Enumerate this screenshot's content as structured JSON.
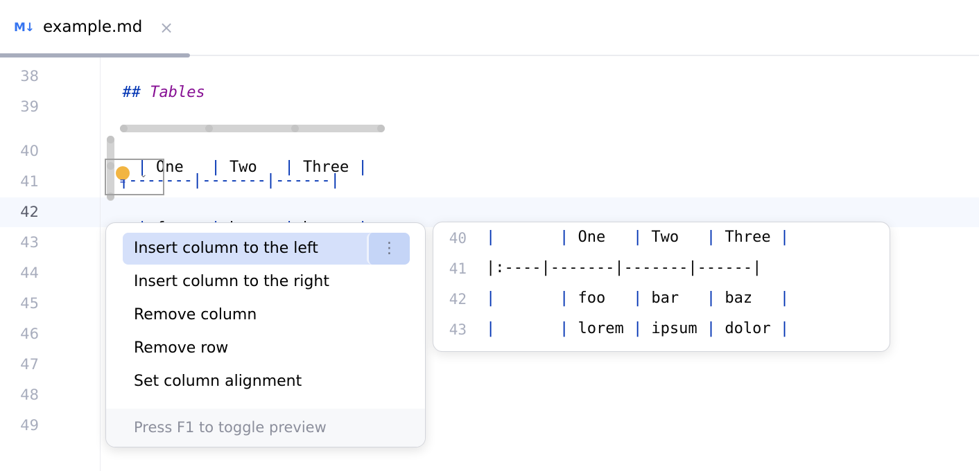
{
  "tab": {
    "icon": "M↓",
    "icon_name": "markdown-file-icon",
    "label": "example.md",
    "close": "×"
  },
  "gutter": {
    "lines": [
      "38",
      "39",
      "40",
      "41",
      "42",
      "43",
      "44",
      "45",
      "46",
      "47",
      "48",
      "49"
    ],
    "current_line": "42"
  },
  "editor": {
    "line38": {
      "hash": "## ",
      "text": "Tables"
    },
    "line40": [
      "| ",
      "One",
      "   | ",
      "Two",
      "   | ",
      "Three",
      " |"
    ],
    "line41": "|-------|-------|------|",
    "line42": [
      "| ",
      "foo",
      "   | ",
      "bar",
      "   | ",
      "baz",
      "   |"
    ]
  },
  "menu": {
    "items": [
      "Insert column to the left",
      "Insert column to the right",
      "Remove column",
      "Remove row",
      "Set column alignment"
    ],
    "selected_index": 0,
    "more_icon": "⋮",
    "footer": "Press F1 to toggle preview"
  },
  "preview": {
    "lines": [
      {
        "num": "40",
        "cells": [
          "",
          "One",
          "Two",
          "Three"
        ]
      },
      {
        "num": "41",
        "separator": "|:----|-------|-------|------|"
      },
      {
        "num": "42",
        "cells": [
          "",
          "foo",
          "bar",
          "baz"
        ]
      },
      {
        "num": "43",
        "cells": [
          "",
          "lorem",
          "ipsum",
          "dolor"
        ]
      }
    ]
  },
  "colors": {
    "accent": "#3574f0",
    "pipe": "#0033b3",
    "header_text": "#871094",
    "selection": "#d5e0fa",
    "bulb": "#f2b542"
  }
}
